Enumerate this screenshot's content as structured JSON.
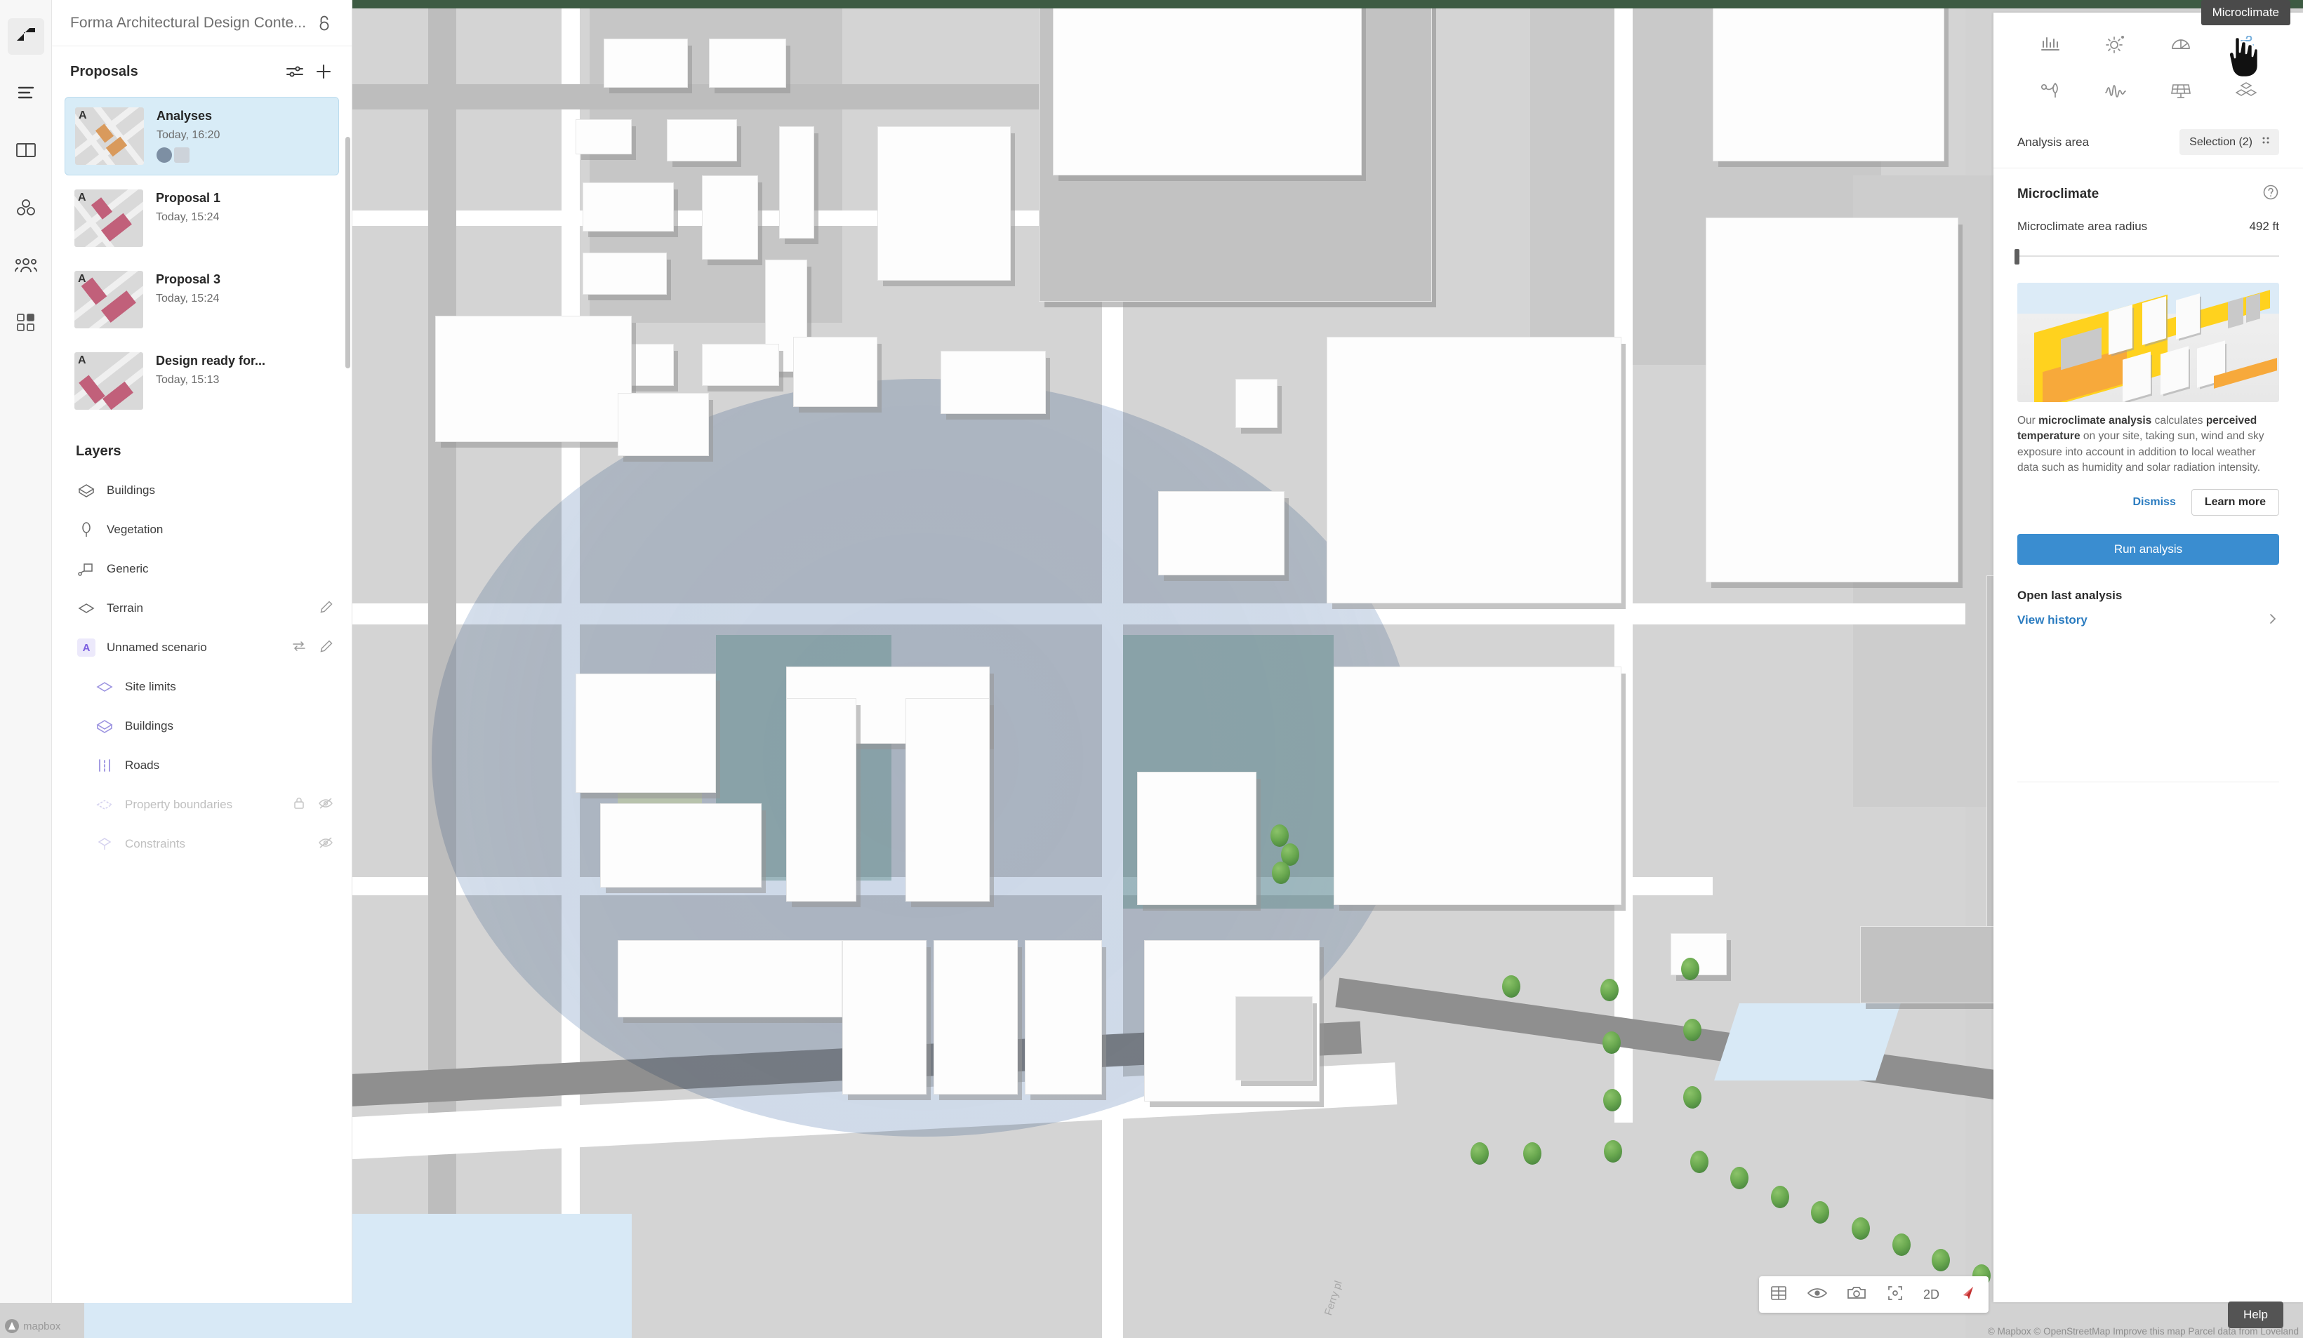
{
  "window": {
    "tooltip": "Microclimate"
  },
  "rail": {
    "items": [
      {
        "name": "forma-logo",
        "icon": "forma-logo-icon"
      },
      {
        "name": "project-list",
        "icon": "list-icon"
      },
      {
        "name": "library",
        "icon": "book-icon"
      },
      {
        "name": "massing",
        "icon": "blocks-icon"
      },
      {
        "name": "collaborate",
        "icon": "people-icon"
      },
      {
        "name": "apps",
        "icon": "grid-apps-icon"
      }
    ]
  },
  "project": {
    "title": "Forma Architectural Design Conte...",
    "share_icon": "share-icon"
  },
  "proposals": {
    "title": "Proposals",
    "filter_icon": "sliders-icon",
    "add_icon": "plus-icon",
    "items": [
      {
        "name": "Analyses",
        "date": "Today, 16:20",
        "tag": "A",
        "selected": true,
        "avatars": 2
      },
      {
        "name": "Proposal 1",
        "date": "Today, 15:24",
        "tag": "A",
        "selected": false,
        "avatars": 0
      },
      {
        "name": "Proposal 3",
        "date": "Today, 15:24",
        "tag": "A",
        "selected": false,
        "avatars": 0
      },
      {
        "name": "Design ready for...",
        "date": "Today, 15:13",
        "tag": "A",
        "selected": false,
        "avatars": 0
      }
    ]
  },
  "layers": {
    "title": "Layers",
    "items": [
      {
        "label": "Buildings",
        "icon": "buildings-icon",
        "sub": false,
        "dim": false,
        "actions": []
      },
      {
        "label": "Vegetation",
        "icon": "tree-icon",
        "sub": false,
        "dim": false,
        "actions": []
      },
      {
        "label": "Generic",
        "icon": "generic-icon",
        "sub": false,
        "dim": false,
        "actions": []
      },
      {
        "label": "Terrain",
        "icon": "terrain-icon",
        "sub": false,
        "dim": false,
        "actions": [
          "edit-icon"
        ]
      },
      {
        "label": "Unnamed scenario",
        "icon": "scenario-badge",
        "sub": false,
        "dim": false,
        "actions": [
          "swap-icon",
          "edit-icon"
        ]
      },
      {
        "label": "Site limits",
        "icon": "site-limits-icon",
        "sub": true,
        "dim": false,
        "actions": []
      },
      {
        "label": "Buildings",
        "icon": "buildings-icon",
        "sub": true,
        "dim": false,
        "actions": []
      },
      {
        "label": "Roads",
        "icon": "roads-icon",
        "sub": true,
        "dim": false,
        "actions": []
      },
      {
        "label": "Property boundaries",
        "icon": "boundaries-icon",
        "sub": true,
        "dim": true,
        "actions": [
          "lock-icon",
          "eye-off-icon"
        ]
      },
      {
        "label": "Constraints",
        "icon": "constraints-icon",
        "sub": true,
        "dim": true,
        "actions": [
          "eye-off-icon"
        ]
      }
    ]
  },
  "toolstrip": {
    "items": [
      {
        "name": "magic-wand-tool",
        "icon": "magic-wand-icon"
      },
      {
        "name": "extrude-tool",
        "icon": "building-extrude-icon"
      },
      {
        "name": "vegetation-tool",
        "icon": "trees-icon"
      },
      {
        "name": "terrain-tool",
        "icon": "terrain-plane-icon"
      },
      {
        "name": "roads-tool",
        "icon": "roads-icon"
      },
      {
        "name": "site-limits-tool",
        "icon": "site-limits-icon"
      },
      {
        "name": "constraints-tool",
        "icon": "volume-icon"
      },
      {
        "name": "measure-tool",
        "icon": "measure-icon"
      },
      {
        "name": "massing-tool",
        "icon": "massing-blocks-icon"
      }
    ]
  },
  "analysis_panel": {
    "icons": [
      {
        "name": "key-metrics",
        "icon": "bar-chart-icon",
        "active": false
      },
      {
        "name": "sun-analysis",
        "icon": "sun-icon",
        "active": false
      },
      {
        "name": "daylight",
        "icon": "sky-dome-icon",
        "active": false
      },
      {
        "name": "wind-analysis",
        "icon": "wind-icon",
        "active": true
      },
      {
        "name": "noise-leaf",
        "icon": "leaf-noise-icon",
        "active": false
      },
      {
        "name": "noise",
        "icon": "waveform-icon",
        "active": false
      },
      {
        "name": "solar-energy",
        "icon": "solar-panel-icon",
        "active": false
      },
      {
        "name": "massing",
        "icon": "massing-blocks-icon",
        "active": false
      }
    ],
    "analysis_area_label": "Analysis area",
    "selection_chip": "Selection (2)",
    "selection_chip_icon": "grid-dots-icon",
    "section_title": "Microclimate",
    "help_icon": "help-circle-icon",
    "radius_label": "Microclimate area radius",
    "radius_value": "492 ft",
    "promo": {
      "paragraph_prefix": "Our ",
      "bold_1": "microclimate analysis",
      "mid_1": " calculates ",
      "bold_2": "perceived temperature",
      "tail": " on your site, taking sun, wind and sky exposure into account in addition to local weather data such as humidity and solar radiation intensity.",
      "dismiss_label": "Dismiss",
      "learn_more_label": "Learn more"
    },
    "run_button": "Run analysis",
    "open_last_analysis": "Open last analysis",
    "view_history": "View history",
    "chevron_icon": "chevron-right-icon",
    "accent_blue": "#3a8dd0",
    "link_blue": "#2b7cc0"
  },
  "viewbar": {
    "items": [
      {
        "name": "grid-view",
        "icon": "grid-icon",
        "label": ""
      },
      {
        "name": "visibility",
        "icon": "eye-icon",
        "label": ""
      },
      {
        "name": "screenshot",
        "icon": "camera-icon",
        "label": ""
      },
      {
        "name": "focus",
        "icon": "focus-icon",
        "label": ""
      },
      {
        "name": "view-mode",
        "icon": "text-label",
        "label": "2D"
      },
      {
        "name": "compass",
        "icon": "compass-icon",
        "label": ""
      }
    ]
  },
  "help_button": "Help",
  "map": {
    "attribution": "© Mapbox © OpenStreetMap Improve this map Parcel data from Loveland",
    "logo_label": "mapbox",
    "street_label": "Ferry pl",
    "colors": {
      "ground": "#d2d2d2",
      "building": "#fdfdfd",
      "water": "#d8e9f6",
      "analysis_overlay": "#567cb0",
      "site_fill": "#608c8a",
      "tree": "#69a84f"
    }
  }
}
